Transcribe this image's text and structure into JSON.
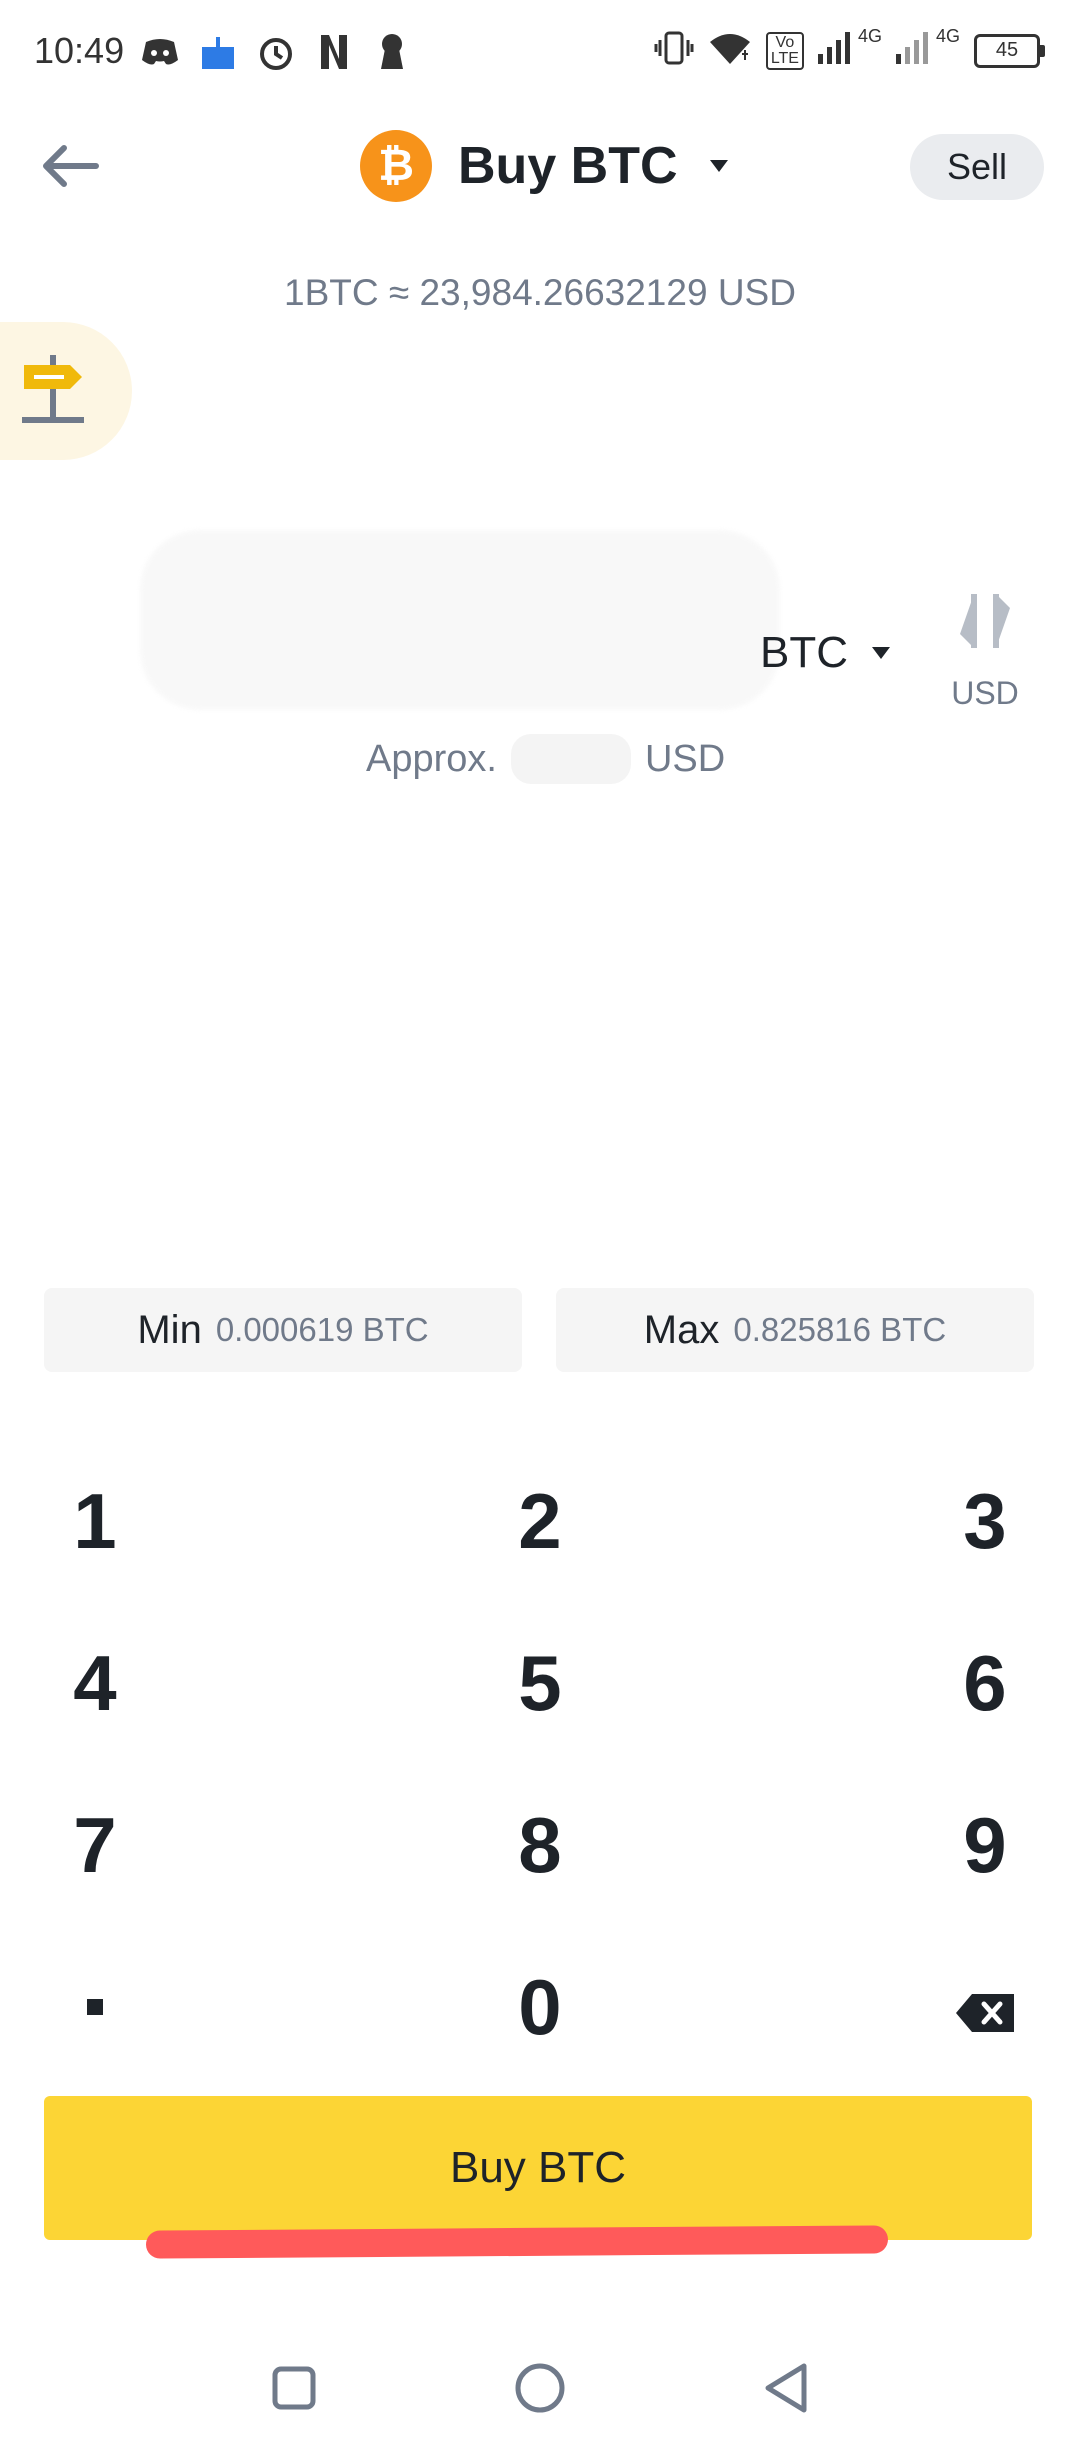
{
  "status_bar": {
    "time": "10:49",
    "icons_left": [
      "discord-icon",
      "cake-icon",
      "alarm-icon",
      "netflix-icon",
      "keyhole-icon"
    ],
    "icons_right": [
      "vibrate-icon",
      "wifi-icon",
      "volte-icon",
      "signal-icon",
      "signal-icon"
    ],
    "volte_label": "Vo\nLTE",
    "net_label_1": "4G",
    "net_label_2": "4G",
    "battery": "45"
  },
  "header": {
    "title": "Buy BTC",
    "coin_symbol": "₿",
    "sell_label": "Sell"
  },
  "rate_text": "1BTC ≈ 23,984.26632129 USD",
  "amount": {
    "unit": "BTC",
    "swap_label": "USD",
    "approx_prefix": "Approx.",
    "approx_suffix": "USD"
  },
  "limits": {
    "min_label": "Min",
    "min_value": "0.000619 BTC",
    "max_label": "Max",
    "max_value": "0.825816 BTC"
  },
  "keypad": {
    "keys": [
      "1",
      "2",
      "3",
      "4",
      "5",
      "6",
      "7",
      "8",
      "9",
      "",
      "0",
      ""
    ]
  },
  "buy_button_label": "Buy BTC",
  "colors": {
    "accent_yellow": "#fcd535",
    "btc_orange": "#f7931a",
    "text_primary": "#1e2329",
    "text_secondary": "#707a8a",
    "annotation_red": "#ff5a5a"
  }
}
